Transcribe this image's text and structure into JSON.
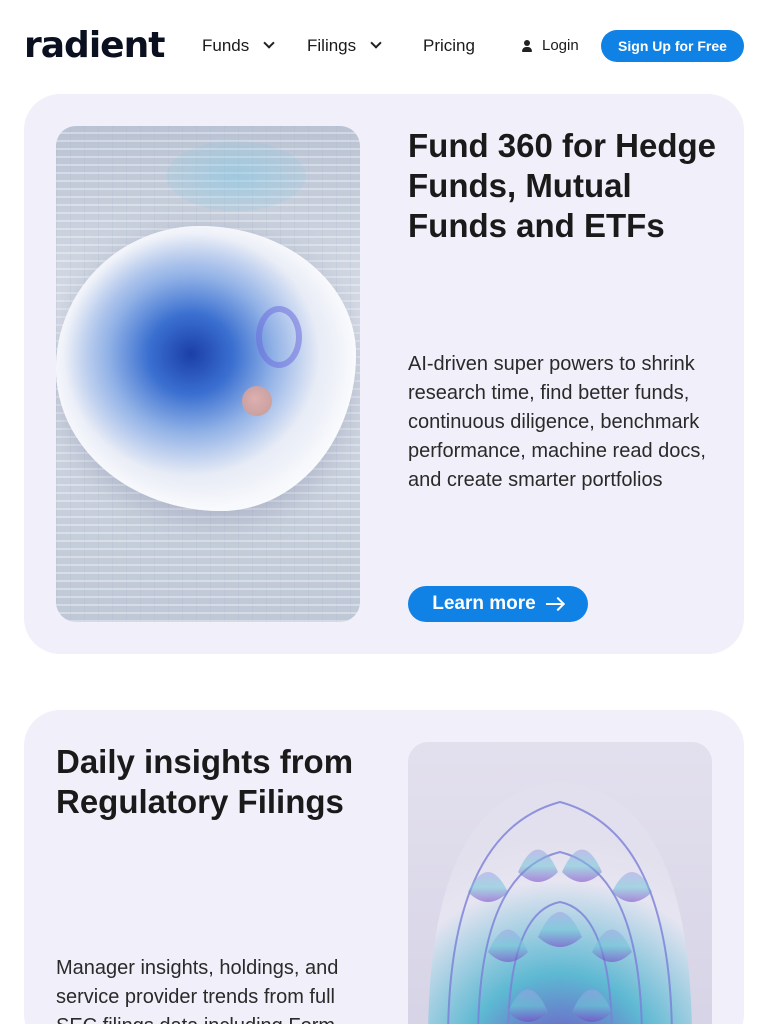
{
  "nav": {
    "logo_text": "radient",
    "funds_label": "Funds",
    "filings_label": "Filings",
    "pricing_label": "Pricing",
    "login_label": "Login",
    "signup_label": "Sign Up for Free"
  },
  "fund360": {
    "title_bold": "Fund 360",
    "title_rest": " for Hedge Funds, Mutual Funds and ETFs",
    "description": "AI-driven super powers to shrink research time, find better funds, continuous diligence, benchmark performance, machine read docs, and create smarter portfolios",
    "cta_label": "Learn more"
  },
  "filings": {
    "title_regular": "Daily insights from",
    "title_bold": "Regulatory Filings",
    "description": "Manager insights, holdings, and service provider trends from full SEC filings data including Form"
  },
  "colors": {
    "accent": "#1082e6",
    "card_bg": "#f1eff9",
    "text": "#1a1a1a"
  },
  "icons": [
    "chevron-down-icon",
    "user-icon",
    "arrow-right-icon"
  ]
}
